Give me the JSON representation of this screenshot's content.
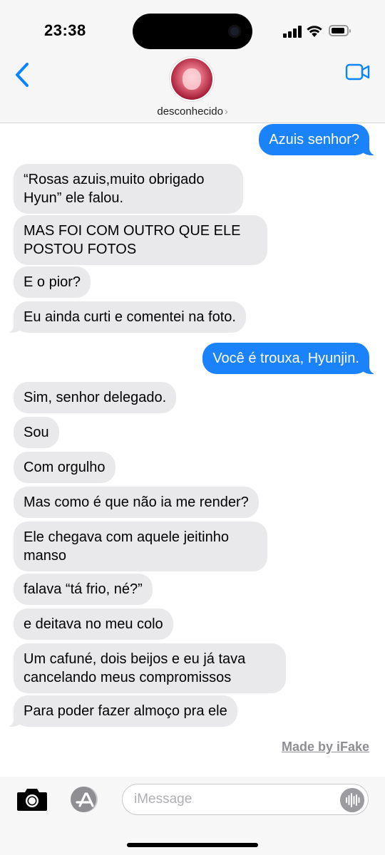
{
  "status_bar": {
    "time": "23:38"
  },
  "header": {
    "contact_name": "desconhecido",
    "contact_chevron": "›"
  },
  "messages": [
    {
      "dir": "out",
      "text": "Azuis senhor?",
      "tail": true
    },
    {
      "dir": "in",
      "text": "“Rosas azuis,muito obrigado Hyun” ele falou.",
      "tail": false
    },
    {
      "dir": "in",
      "text": "MAS FOI COM OUTRO QUE ELE POSTOU FOTOS",
      "tail": false
    },
    {
      "dir": "in",
      "text": "E o pior?",
      "tail": false
    },
    {
      "dir": "in",
      "text": "Eu ainda curti e comentei na foto.",
      "tail": true
    },
    {
      "dir": "out",
      "text": "Você é trouxa, Hyunjin.",
      "tail": true
    },
    {
      "dir": "in",
      "text": "Sim, senhor delegado.",
      "tail": false
    },
    {
      "dir": "in",
      "text": "Sou",
      "tail": false
    },
    {
      "dir": "in",
      "text": "Com orgulho",
      "tail": false
    },
    {
      "dir": "in",
      "text": "Mas como é que não ia me render?",
      "tail": false
    },
    {
      "dir": "in",
      "text": "Ele chegava com aquele jeitinho manso",
      "tail": false
    },
    {
      "dir": "in",
      "text": "falava “tá frio, né?”",
      "tail": false
    },
    {
      "dir": "in",
      "text": "e deitava no meu colo",
      "tail": false
    },
    {
      "dir": "in",
      "text": "Um cafuné, dois beijos e eu já tava cancelando meus compromissos",
      "tail": false
    },
    {
      "dir": "in",
      "text": "Para poder fazer almoço pra ele",
      "tail": true
    }
  ],
  "watermark": "Made by iFake",
  "compose": {
    "placeholder": "iMessage",
    "value": ""
  },
  "colors": {
    "outgoing_bubble": "#1a82fb",
    "incoming_bubble": "#e9e9eb",
    "accent": "#0a84ff"
  },
  "icons": {
    "back": "chevron-left-icon",
    "video": "video-camera-icon",
    "camera": "camera-icon",
    "apps": "app-store-icon",
    "audio": "audio-waveform-icon"
  }
}
